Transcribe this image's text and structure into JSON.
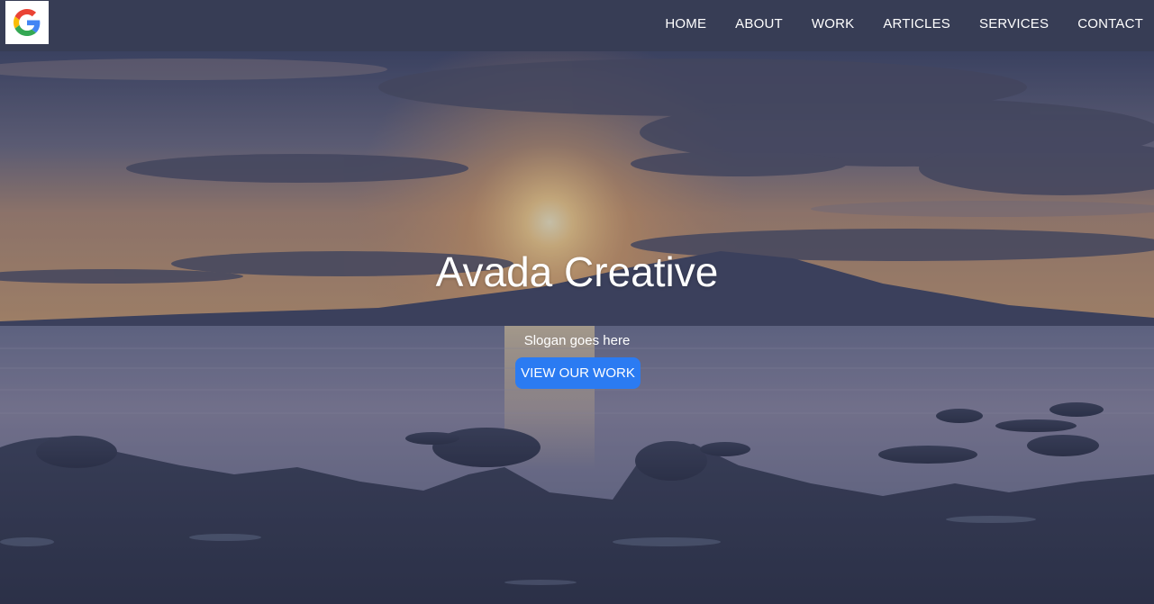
{
  "header": {
    "logo": {
      "icon": "google-g-icon"
    },
    "nav": [
      {
        "label": "HOME"
      },
      {
        "label": "ABOUT"
      },
      {
        "label": "WORK"
      },
      {
        "label": "ARTICLES"
      },
      {
        "label": "SERVICES"
      },
      {
        "label": "CONTACT"
      }
    ]
  },
  "hero": {
    "title": "Avada Creative",
    "slogan": "Slogan goes here",
    "cta_label": "VIEW OUR WORK",
    "background": "sunset-over-sea-with-rocky-shore"
  },
  "colors": {
    "nav_background": "#373d55",
    "button": "#2b7bf2",
    "text": "#ffffff"
  }
}
